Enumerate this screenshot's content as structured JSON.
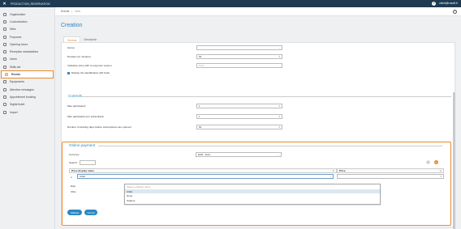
{
  "topbar": {
    "app_name": "PRODUCTION_RESERVATION",
    "user": "client@rosoft.fr"
  },
  "breadcrumb": {
    "root": "Events",
    "current": "New"
  },
  "sidebar": {
    "items": [
      {
        "label": "Organization"
      },
      {
        "label": "Customization"
      },
      {
        "label": "Sites"
      },
      {
        "label": "Purposes"
      },
      {
        "label": "Opening hours"
      },
      {
        "label": "Reception workstations"
      },
      {
        "label": "Users"
      },
      {
        "label": "Skills set"
      },
      {
        "label": "Events"
      },
      {
        "label": "Equipments"
      },
      {
        "label": "Attention messages"
      },
      {
        "label": "Appointment booking"
      },
      {
        "label": "Digital ticket"
      },
      {
        "label": "Import"
      }
    ]
  },
  "page": {
    "title": "Creation"
  },
  "tabs": [
    {
      "label": "General"
    },
    {
      "label": "Description"
    }
  ],
  "form": {
    "group_label": "Group",
    "duration_label": "Duration (in minutes)",
    "duration_value": "60",
    "indicative_price_label": "Indicative price with no payment system",
    "indicative_price_placeholder": "Price",
    "display_qr_label": "Display the identification QR Code"
  },
  "controls": {
    "title": "Controls",
    "max_participants_label": "Max participants",
    "max_participants_value": "1",
    "max_per_subscription_label": "Max participants per subscription",
    "max_per_subscription_value": "1",
    "working_days_label": "Number of working days before subscriptions are opened",
    "working_days_value": "60"
  },
  "online_payment": {
    "title": "Online payment",
    "currency_label": "Currency",
    "currency_value": "EUR - Euro",
    "search_label": "Search:",
    "col_price_display_name": "Price display name",
    "col_price": "Price",
    "row_value": "Child",
    "row_label_partial": "Disp",
    "row_label_partial2": "Othe",
    "dropdown_options": [
      "Select a display name",
      "Child",
      "None",
      "Student"
    ]
  },
  "buttons": {
    "validate": "Validate",
    "cancel": "Cancel"
  }
}
